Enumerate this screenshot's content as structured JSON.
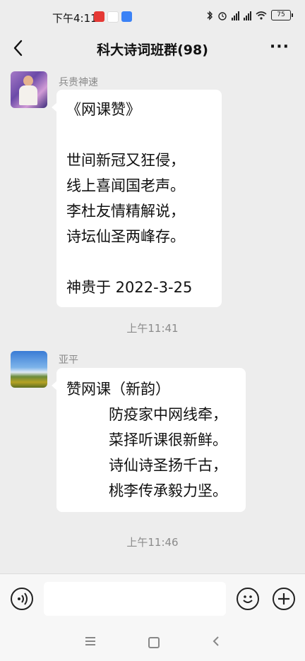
{
  "status": {
    "time": "下午4:11",
    "app1": "",
    "app2": "",
    "app3": "",
    "battery": "75"
  },
  "header": {
    "title": "科大诗词班群(98)"
  },
  "messages": [
    {
      "sender": "兵贵神速",
      "lines": [
        "《网课赞》",
        "",
        "世间新冠又狂侵，",
        "线上喜闻国老声。",
        "李杜友情精解说，",
        "诗坛仙圣两峰存。",
        "",
        "神贵于 2022-3-25"
      ]
    },
    {
      "sender": "亚平",
      "lines": [
        "赞网课（新韵）",
        "防疫家中网线牵，",
        "菜择听课很新鲜。",
        "诗仙诗圣扬千古，",
        "桃李传承毅力坚。"
      ]
    }
  ],
  "timestamps": [
    "上午11:41",
    "上午11:46"
  ],
  "input": {
    "value": "",
    "placeholder": ""
  },
  "icons": {
    "back": "chevron-left-icon",
    "more": "more-icon",
    "voice": "voice-icon",
    "emoji": "emoji-icon",
    "plus": "plus-icon"
  },
  "colors": {
    "background": "#ededed",
    "bubble": "#ffffff",
    "timestamp": "#8b8b8b"
  }
}
